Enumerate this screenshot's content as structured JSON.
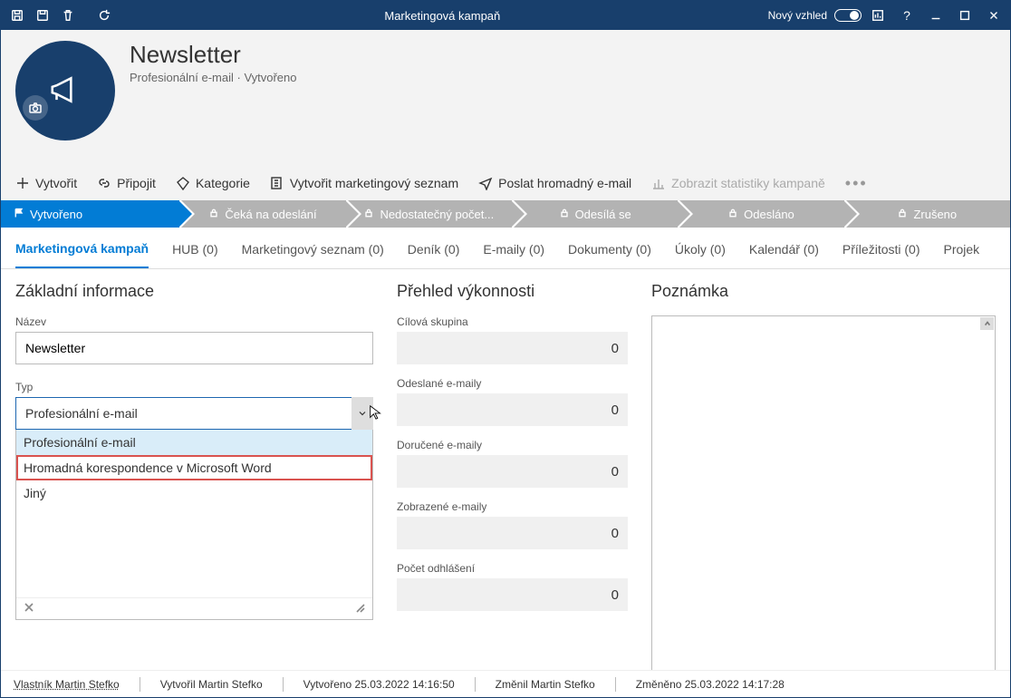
{
  "title_bar": {
    "title": "Marketingová kampaň",
    "new_look": "Nový vzhled"
  },
  "header": {
    "title": "Newsletter",
    "subtitle": "Profesionální e-mail  ·  Vytvořeno"
  },
  "commands": {
    "create": "Vytvořit",
    "link": "Připojit",
    "category": "Kategorie",
    "mk_list": "Vytvořit marketingový seznam",
    "send_mass": "Poslat hromadný e-mail",
    "stats": "Zobrazit statistiky kampaně"
  },
  "stages": [
    "Vytvořeno",
    "Čeká na odeslání",
    "Nedostatečný počet...",
    "Odesílá se",
    "Odesláno",
    "Zrušeno"
  ],
  "tabs": [
    "Marketingová kampaň",
    "HUB (0)",
    "Marketingový seznam (0)",
    "Deník (0)",
    "E-maily (0)",
    "Dokumenty (0)",
    "Úkoly (0)",
    "Kalendář (0)",
    "Příležitosti (0)",
    "Projek"
  ],
  "sections": {
    "basic": "Základní informace",
    "perf": "Přehled výkonnosti",
    "note": "Poznámka"
  },
  "fields": {
    "name_label": "Název",
    "name_value": "Newsletter",
    "type_label": "Typ",
    "type_value": "Profesionální e-mail",
    "type_options": [
      "Profesionální e-mail",
      "Hromadná korespondence v Microsoft Word",
      "Jiný"
    ]
  },
  "metrics": {
    "target_group_label": "Cílová skupina",
    "target_group_value": "0",
    "sent_label": "Odeslané e-maily",
    "sent_value": "0",
    "delivered_label": "Doručené e-maily",
    "delivered_value": "0",
    "viewed_label": "Zobrazené e-maily",
    "viewed_value": "0",
    "unsub_label": "Počet odhlášení",
    "unsub_value": "0"
  },
  "status": {
    "owner": "Vlastník Martin Stefko",
    "created_by": "Vytvořil Martin Stefko",
    "created_at": "Vytvořeno 25.03.2022 14:16:50",
    "modified_by": "Změnil Martin Stefko",
    "modified_at": "Změněno 25.03.2022 14:17:28"
  }
}
